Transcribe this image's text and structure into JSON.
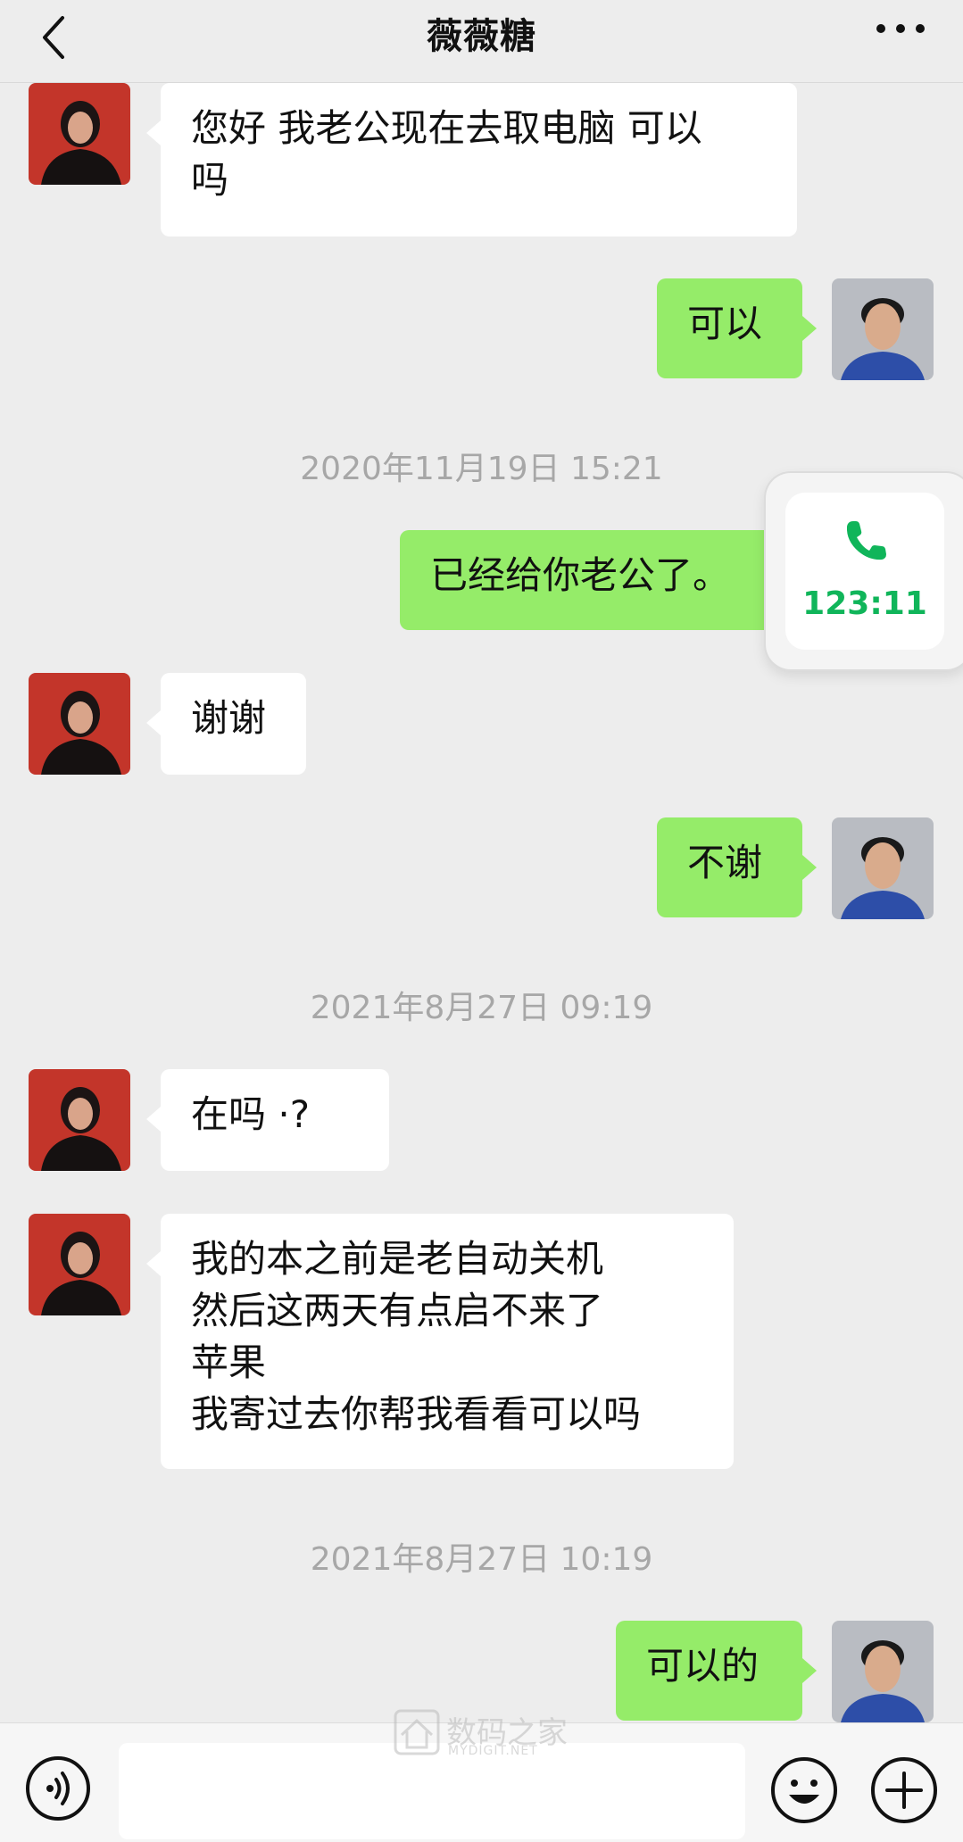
{
  "header": {
    "title": "薇薇糖"
  },
  "messages": [
    {
      "dir": "in",
      "text": "您好 我老公现在去取电脑 可以\n吗"
    },
    {
      "dir": "out",
      "text": "可以"
    },
    {
      "dir": "out",
      "text": "已经给你老公了。"
    },
    {
      "dir": "in",
      "text": "谢谢"
    },
    {
      "dir": "out",
      "text": "不谢"
    },
    {
      "dir": "in",
      "text": "在吗 ·?"
    },
    {
      "dir": "in",
      "text": "我的本之前是老自动关机\n然后这两天有点启不来了\n苹果\n我寄过去你帮我看看可以吗"
    },
    {
      "dir": "out",
      "text": "可以的"
    }
  ],
  "timestamps": [
    "2020年11月19日 15:21",
    "2021年8月27日 09:19",
    "2021年8月27日 10:19"
  ],
  "call_card": {
    "icon": "phone-icon",
    "duration": "123:11",
    "color": "#10b55a"
  },
  "watermark": {
    "cn": "数码之家",
    "en": "MYDIGIT.NET"
  },
  "input_bar": {
    "placeholder": ""
  },
  "colors": {
    "background": "#ededed",
    "incoming_bubble": "#ffffff",
    "outgoing_bubble": "#95ec69",
    "timestamp": "#a7a7a7"
  }
}
